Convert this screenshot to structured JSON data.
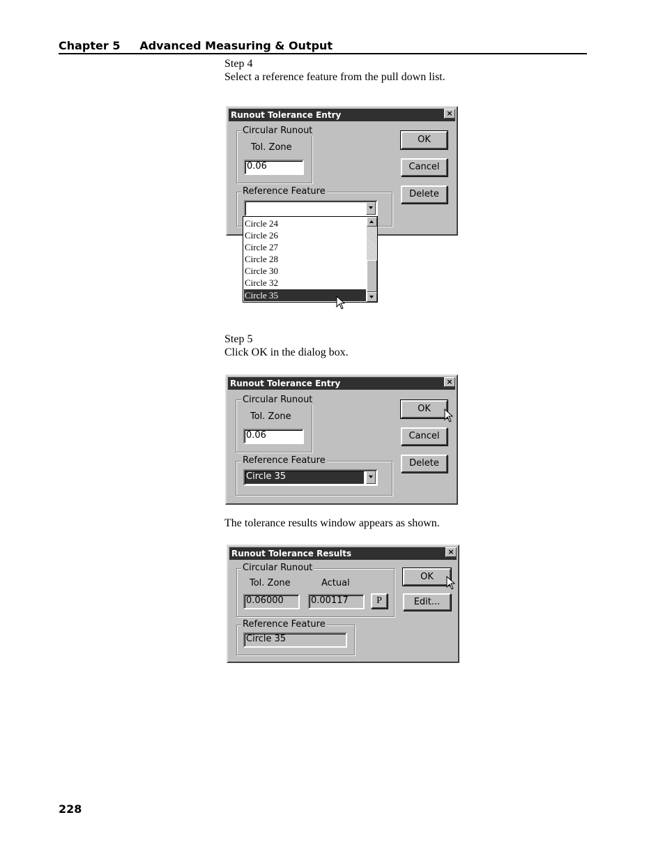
{
  "header": {
    "chapter": "Chapter 5",
    "title": "Advanced Measuring & Output"
  },
  "step4": {
    "label": "Step 4",
    "text": "Select a reference feature from the pull down list."
  },
  "dialog1": {
    "title": "Runout Tolerance Entry",
    "close_glyph": "×",
    "group_label": "Circular Runout",
    "tol_zone_label": "Tol. Zone",
    "tol_zone_value": "0.06",
    "ref_group_label": "Reference Feature",
    "ref_value": "",
    "ok_label": "OK",
    "cancel_label": "Cancel",
    "delete_label": "Delete",
    "list_items": [
      "Circle 24",
      "Circle 26",
      "Circle 27",
      "Circle 28",
      "Circle 30",
      "Circle 32",
      "Circle 35"
    ],
    "list_selected": "Circle 35"
  },
  "step5": {
    "label": "Step 5",
    "text": "Click OK in the dialog box."
  },
  "dialog2": {
    "title": "Runout Tolerance Entry",
    "close_glyph": "×",
    "group_label": "Circular Runout",
    "tol_zone_label": "Tol. Zone",
    "tol_zone_value": "0.06",
    "ref_group_label": "Reference Feature",
    "ref_value": "Circle 35",
    "ok_label": "OK",
    "cancel_label": "Cancel",
    "delete_label": "Delete"
  },
  "results_text": "The tolerance results window appears as shown.",
  "dialog3": {
    "title": "Runout Tolerance Results",
    "close_glyph": "×",
    "group_label": "Circular Runout",
    "tol_zone_label": "Tol. Zone",
    "actual_label": "Actual",
    "tol_zone_value": "0.06000",
    "actual_value": "0.00117",
    "status": "P",
    "ref_group_label": "Reference Feature",
    "ref_value": "Circle 35",
    "ok_label": "OK",
    "edit_label": "Edit..."
  },
  "page_number": "228"
}
